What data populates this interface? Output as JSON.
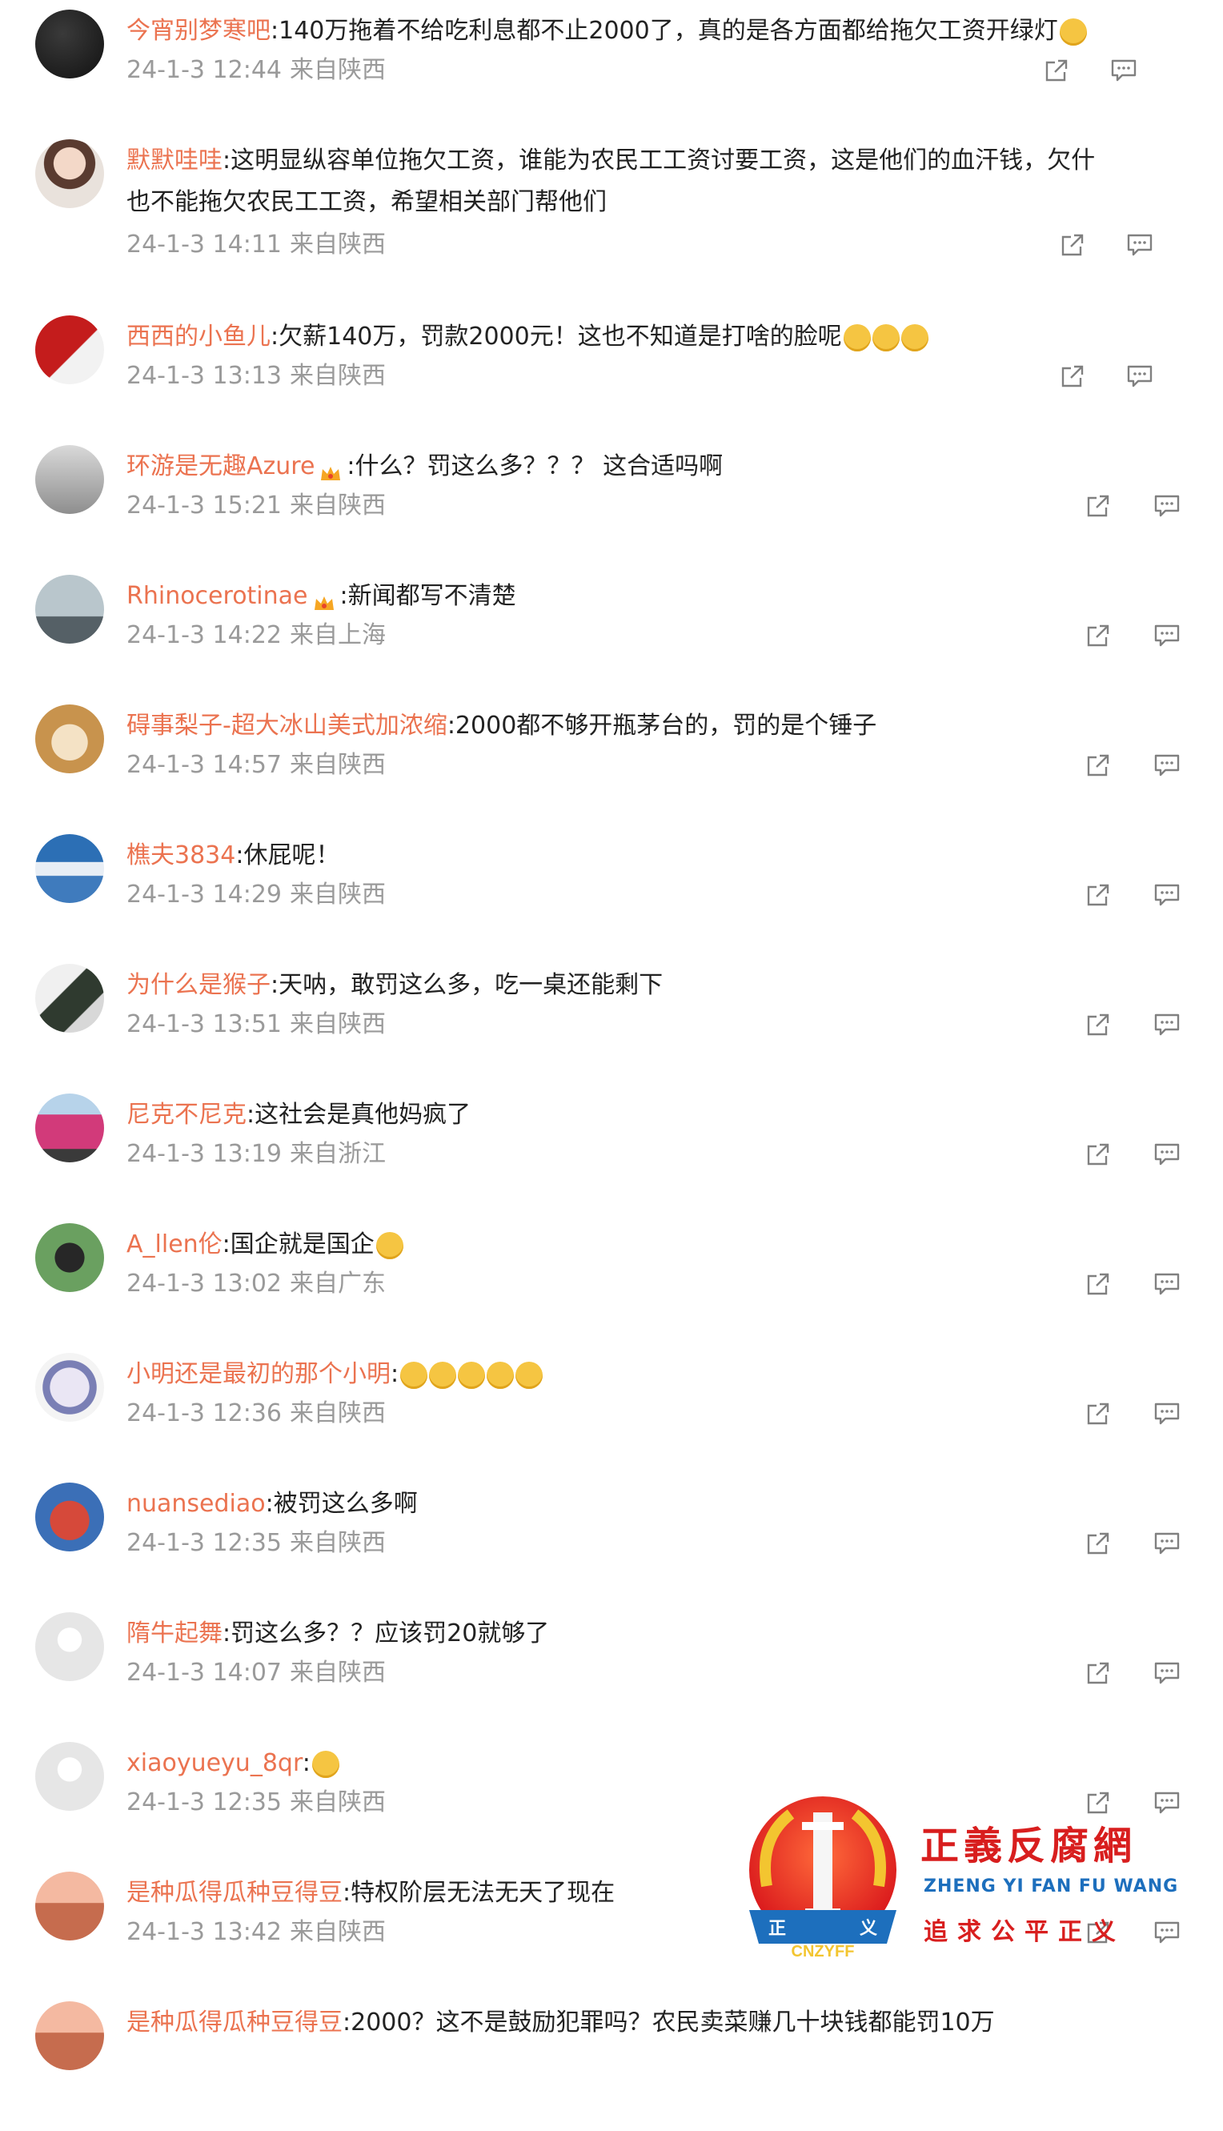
{
  "comments": [
    {
      "user": "今宵别梦寒吧",
      "text": ":140万拖着不给吃利息都不止2000了，真的是各方面都给拖欠工资开绿灯",
      "emojis": 1,
      "time": "24-1-3 12:44",
      "location": "来自陕西",
      "crown": false,
      "avatar": "dark"
    },
    {
      "user": "默默哇哇",
      "text": ":这明显纵容单位拖欠工资，谁能为农民工工资讨要工资，这是他们的血汗钱，欠什",
      "text2": "也不能拖欠农民工工资，希望相关部门帮他们",
      "time": "24-1-3 14:11",
      "location": "来自陕西",
      "crown": false,
      "avatar": "girl"
    },
    {
      "user": "西西的小鱼儿",
      "text": ":欠薪140万，罚款2000元！这也不知道是打啥的脸呢",
      "emojis": 3,
      "time": "24-1-3 13:13",
      "location": "来自陕西",
      "crown": false,
      "avatar": "red"
    },
    {
      "user": "环游是无趣Azure",
      "text": ":什么？罚这么多？？？ 这合适吗啊",
      "time": "24-1-3 15:21",
      "location": "来自陕西",
      "crown": true,
      "avatar": "gray"
    },
    {
      "user": "Rhinocerotinae",
      "text": ":新闻都写不清楚",
      "time": "24-1-3 14:22",
      "location": "来自上海",
      "crown": true,
      "avatar": "tree"
    },
    {
      "user": "碍事梨子-超大冰山美式加浓缩",
      "text": ":2000都不够开瓶茅台的，罚的是个锤子",
      "time": "24-1-3 14:57",
      "location": "来自陕西",
      "crown": false,
      "avatar": "dog"
    },
    {
      "user": "樵夫3834",
      "text": ":休屁呢！",
      "time": "24-1-3 14:29",
      "location": "来自陕西",
      "crown": false,
      "avatar": "sky"
    },
    {
      "user": "为什么是猴子",
      "text": ":天呐，敢罚这么多，吃一桌还能剩下",
      "time": "24-1-3 13:51",
      "location": "来自陕西",
      "crown": false,
      "avatar": "ink"
    },
    {
      "user": "尼克不尼克",
      "text": ":这社会是真他妈疯了",
      "time": "24-1-3 13:19",
      "location": "来自浙江",
      "crown": false,
      "avatar": "person"
    },
    {
      "user": "A_llen伦",
      "text": ":国企就是国企",
      "emojis": 1,
      "time": "24-1-3 13:02",
      "location": "来自广东",
      "crown": false,
      "avatar": "flower"
    },
    {
      "user": "小明还是最初的那个小明",
      "text": ":",
      "emojis": 5,
      "time": "24-1-3 12:36",
      "location": "来自陕西",
      "crown": false,
      "avatar": "cartoon"
    },
    {
      "user": "nuansediao",
      "text": ":被罚这么多啊",
      "time": "24-1-3 12:35",
      "location": "来自陕西",
      "crown": false,
      "avatar": "face"
    },
    {
      "user": "隋牛起舞",
      "text": ":罚这么多？？应该罚20就够了",
      "time": "24-1-3 14:07",
      "location": "来自陕西",
      "crown": false,
      "avatar": "default"
    },
    {
      "user": "xiaoyueyu_8qr",
      "text": ":",
      "emojis": 1,
      "time": "24-1-3 12:35",
      "location": "来自陕西",
      "crown": false,
      "avatar": "default"
    },
    {
      "user": "是种瓜得瓜种豆得豆",
      "text": ":特权阶层无法无天了现在",
      "time": "24-1-3 13:42",
      "location": "来自陕西",
      "crown": false,
      "avatar": "sunset"
    },
    {
      "user": "是种瓜得瓜种豆得豆",
      "text": ":2000？这不是鼓励犯罪吗？农民卖菜赚几十块钱都能罚10万",
      "time": "",
      "location": "",
      "crown": false,
      "avatar": "sunset"
    }
  ],
  "watermark": {
    "title": "正義反腐網",
    "pinyin": "ZHENG YI FAN FU WANG",
    "slogan": "追求公平正义",
    "logo_text": "CNZYFF",
    "logo_chars": [
      "正",
      "义"
    ]
  },
  "colors": {
    "username": "#eb7350",
    "meta": "#9a9a9a",
    "text": "#222222",
    "watermark_red": "#d81e1e",
    "watermark_blue": "#1d6fbd"
  }
}
